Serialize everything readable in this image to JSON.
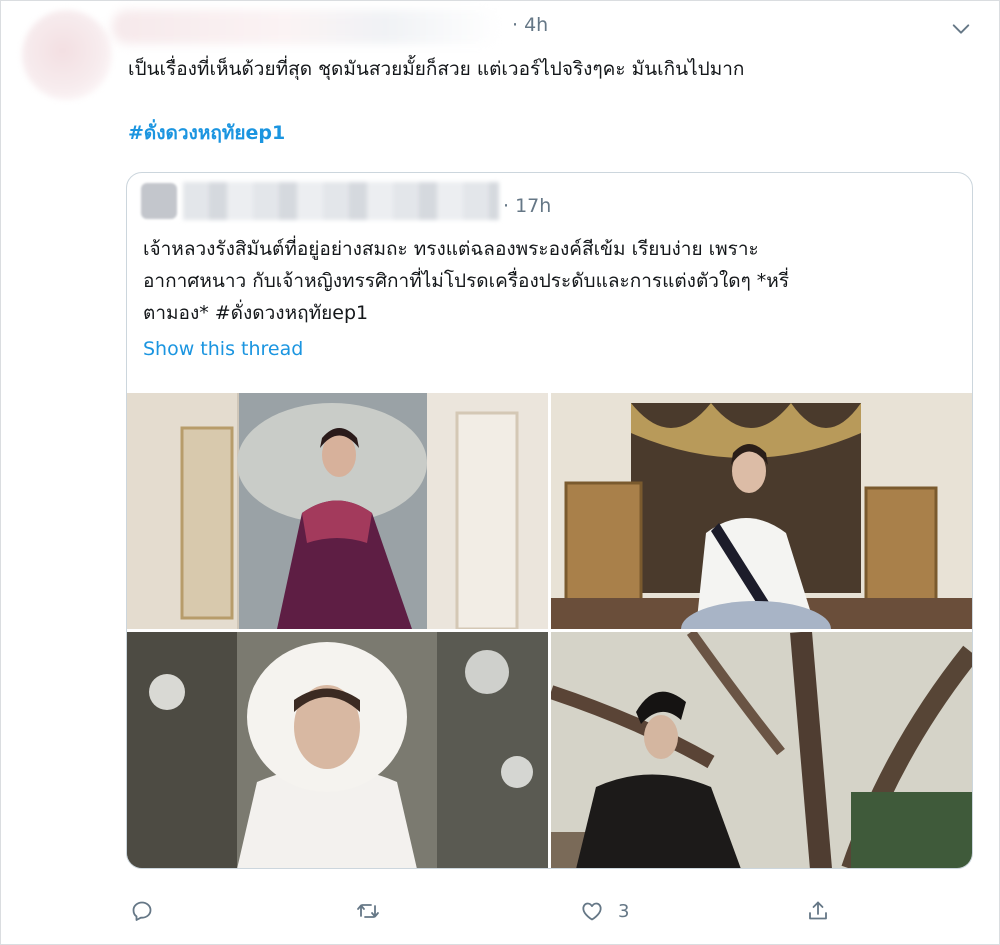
{
  "tweet": {
    "time": "· 4h",
    "text": "เป็นเรื่องที่เห็นด้วยที่สุด ชุดมันสวยมั้ยก็สวย แต่เวอร์ไปจริงๆคะ มันเกินไปมาก",
    "hashtag": "#ดั่งดวงหฤทัยep1"
  },
  "quoted": {
    "time": "· 17h",
    "text": "เจ้าหลวงรังสิมันต์ที่อยู่อย่างสมถะ ทรงแต่ฉลองพระองค์สีเข้ม เรียบง่าย เพราะ\nอากาศหนาว กับเจ้าหญิงทรรศิกาที่ไม่โปรดเครื่องประดับและการแต่งตัวใดๆ *หรี่\nตามอง* #ดั่งดวงหฤทัยep1",
    "show_thread": "Show this thread"
  },
  "actions": {
    "like_count": "3"
  },
  "icons": [
    "chevron-down-icon",
    "reply-icon",
    "retweet-icon",
    "like-icon",
    "share-icon"
  ],
  "colors": {
    "link": "#1b95e0",
    "secondary_text": "#657786",
    "border": "#ccd6dd"
  }
}
